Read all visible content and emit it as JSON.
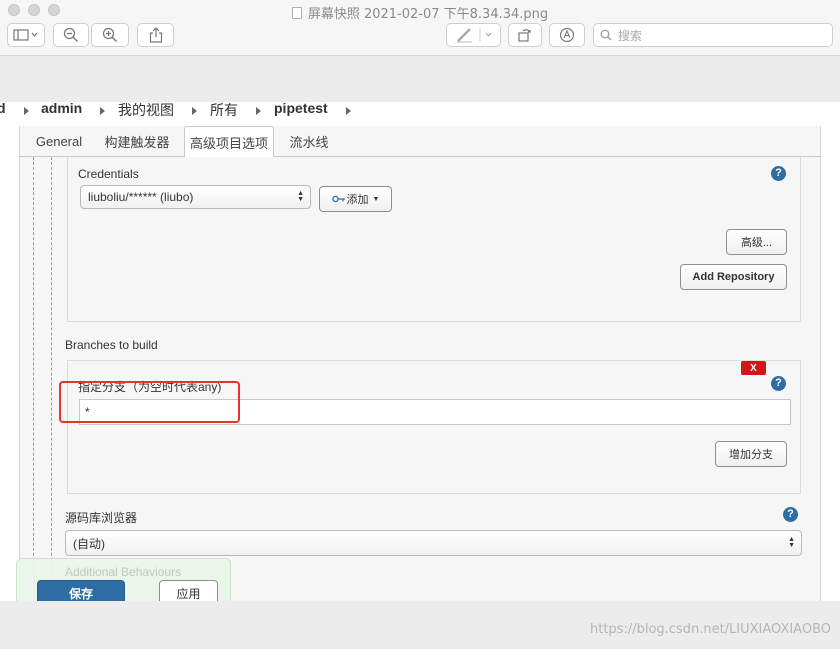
{
  "window": {
    "title": "屏幕快照 2021-02-07 下午8.34.34.png",
    "search_placeholder": "搜索",
    "toolbar_icons": [
      "sidebar-toggle-icon",
      "zoom-out-icon",
      "zoom-in-icon",
      "share-icon",
      "markup-pen-icon",
      "rotate-icon",
      "annotate-icon",
      "search-icon"
    ]
  },
  "breadcrumb": {
    "items": [
      "d",
      "admin",
      "我的视图",
      "所有",
      "pipetest"
    ]
  },
  "tabs": [
    "General",
    "构建触发器",
    "高级项目选项",
    "流水线"
  ],
  "repository": {
    "credentials_label": "Credentials",
    "credentials_value": "liuboliu/****** (liubo)",
    "add_label": "添加",
    "advanced_label": "高级...",
    "add_repository_label": "Add Repository"
  },
  "branches": {
    "section_label": "Branches to build",
    "delete_label": "X",
    "branch_label": "指定分支（为空时代表any)",
    "branch_value": "*",
    "add_branch_label": "增加分支"
  },
  "browser": {
    "label": "源码库浏览器",
    "value": "(自动)"
  },
  "behaviours": {
    "label": "Additional Behaviours"
  },
  "actions": {
    "save_label": "保存",
    "apply_label": "应用"
  },
  "watermark": "https://blog.csdn.net/LIUXIAOXIAOBO",
  "colors": {
    "accent": "#2e6da4",
    "danger": "#d21515",
    "highlight": "#e8322f"
  }
}
